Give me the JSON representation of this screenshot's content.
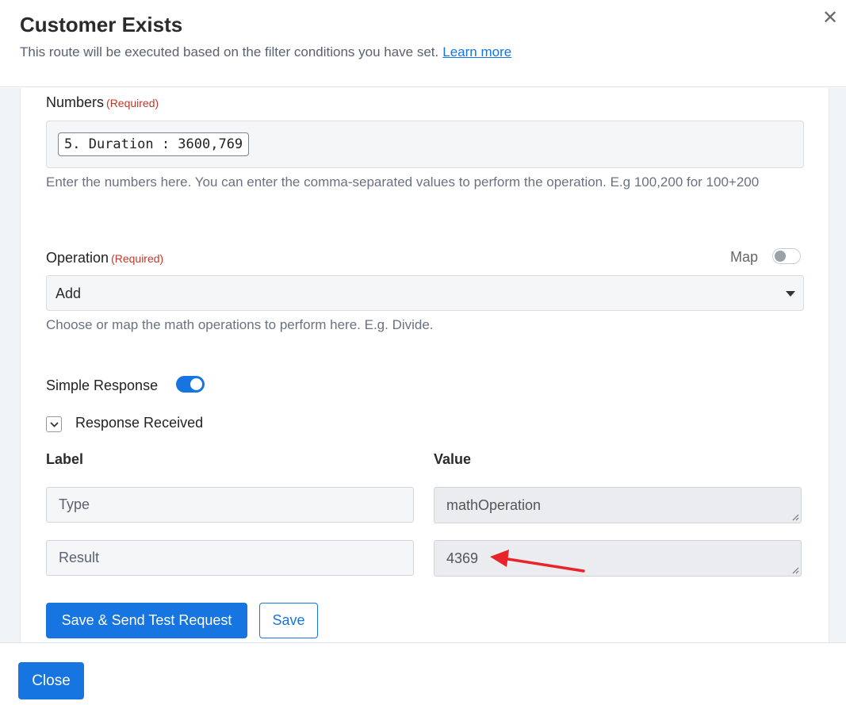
{
  "header": {
    "title": "Customer Exists",
    "subtitle": "This route will be executed based on the filter conditions you have set.",
    "learn_more": "Learn more",
    "close_glyph": "✕"
  },
  "numbers": {
    "label": "Numbers",
    "required": "(Required)",
    "chip": "5. Duration : 3600,769",
    "help": "Enter the numbers here. You can enter the comma-separated values to perform the operation. E.g 100,200 for 100+200"
  },
  "operation": {
    "label": "Operation",
    "required": "(Required)",
    "map_label": "Map",
    "map_enabled": false,
    "selected": "Add",
    "help": "Choose or map the math operations to perform here. E.g. Divide."
  },
  "simple_response": {
    "label": "Simple Response",
    "enabled": true
  },
  "response_received": {
    "label": "Response Received",
    "expanded": true,
    "col_label": "Label",
    "col_value": "Value",
    "rows": [
      {
        "label": "Type",
        "value": "mathOperation"
      },
      {
        "label": "Result",
        "value": "4369"
      }
    ]
  },
  "actions": {
    "save_send": "Save & Send Test Request",
    "save": "Save"
  },
  "footer": {
    "close": "Close"
  },
  "colors": {
    "accent": "#1675e0",
    "required": "#c0392b",
    "annotation_arrow": "#e8242a"
  }
}
